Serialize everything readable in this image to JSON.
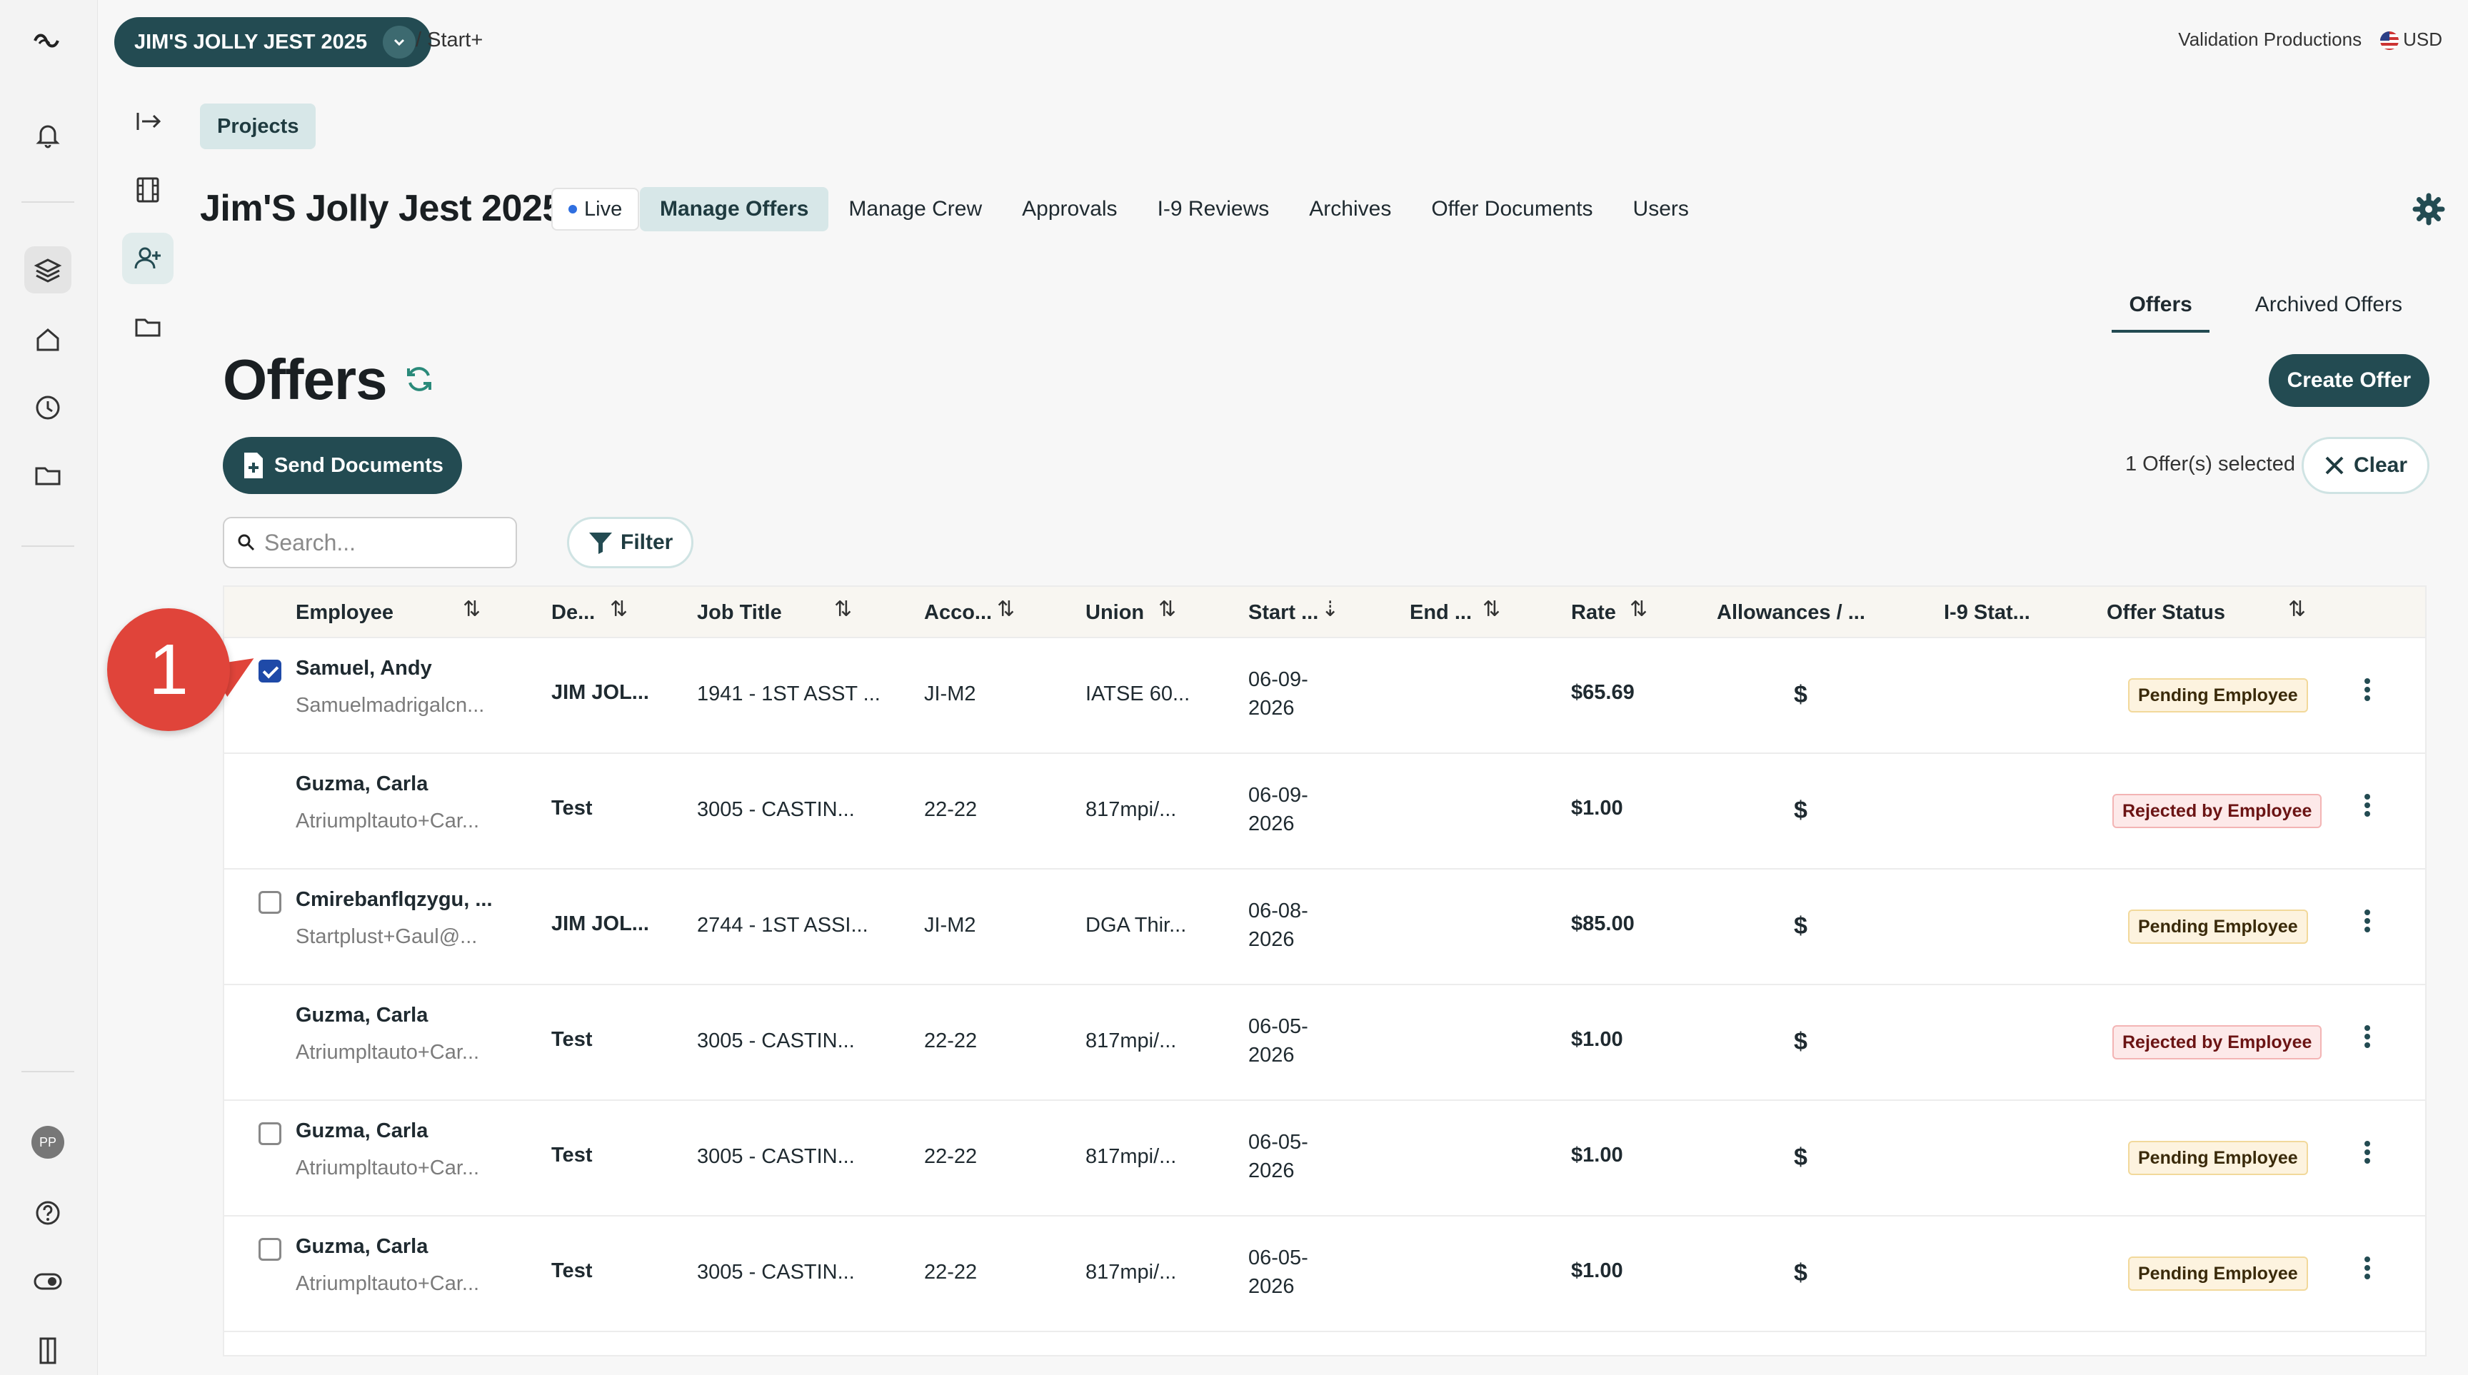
{
  "topbar": {
    "project_pill": "JIM'S JOLLY JEST 2025",
    "breadcrumb": "/ Start+",
    "company": "Validation Productions",
    "currency": "USD"
  },
  "projects_button": "Projects",
  "project": {
    "title": "Jim'S Jolly Jest 2025",
    "status": "Live"
  },
  "nav": [
    {
      "label": "Manage Offers",
      "active": true
    },
    {
      "label": "Manage Crew"
    },
    {
      "label": "Approvals"
    },
    {
      "label": "I-9 Reviews"
    },
    {
      "label": "Archives"
    },
    {
      "label": "Offer Documents"
    },
    {
      "label": "Users"
    }
  ],
  "subtabs": [
    "Offers",
    "Archived Offers"
  ],
  "heading": "Offers",
  "actions": {
    "create_offer": "Create Offer",
    "send_documents": "Send Documents",
    "selected_text": "1 Offer(s) selected",
    "clear": "Clear",
    "filter": "Filter"
  },
  "search": {
    "placeholder": "Search..."
  },
  "columns": [
    "Employee",
    "De...",
    "Job Title",
    "Acco...",
    "Union",
    "Start ...",
    "End ...",
    "Rate",
    "Allowances / ...",
    "I-9 Stat...",
    "Offer Status"
  ],
  "rows": [
    {
      "name": "Samuel, Andy",
      "email": "Samuelmadrigalcn...",
      "dept": "JIM JOL...",
      "job": "1941 - 1ST ASST ...",
      "acct": "JI-M2",
      "union": "IATSE 60...",
      "start1": "06-09-",
      "start2": "2026",
      "rate": "$65.69",
      "allow": "$",
      "status": "Pending Employee",
      "checked": true
    },
    {
      "name": "Guzma, Carla",
      "email": "Atriumpltauto+Car...",
      "dept": "Test",
      "job": "3005 - CASTIN...",
      "acct": "22-22",
      "union": "817mpi/...",
      "start1": "06-09-",
      "start2": "2026",
      "rate": "$1.00",
      "allow": "$",
      "status": "Rejected by Employee"
    },
    {
      "name": "Cmirebanflqzygu, ...",
      "email": "Startplust+Gaul@...",
      "dept": "JIM JOL...",
      "job": "2744 - 1ST ASSI...",
      "acct": "JI-M2",
      "union": "DGA Thir...",
      "start1": "06-08-",
      "start2": "2026",
      "rate": "$85.00",
      "allow": "$",
      "status": "Pending Employee"
    },
    {
      "name": "Guzma, Carla",
      "email": "Atriumpltauto+Car...",
      "dept": "Test",
      "job": "3005 - CASTIN...",
      "acct": "22-22",
      "union": "817mpi/...",
      "start1": "06-05-",
      "start2": "2026",
      "rate": "$1.00",
      "allow": "$",
      "status": "Rejected by Employee"
    },
    {
      "name": "Guzma, Carla",
      "email": "Atriumpltauto+Car...",
      "dept": "Test",
      "job": "3005 - CASTIN...",
      "acct": "22-22",
      "union": "817mpi/...",
      "start1": "06-05-",
      "start2": "2026",
      "rate": "$1.00",
      "allow": "$",
      "status": "Pending Employee"
    },
    {
      "name": "Guzma, Carla",
      "email": "Atriumpltauto+Car...",
      "dept": "Test",
      "job": "3005 - CASTIN...",
      "acct": "22-22",
      "union": "817mpi/...",
      "start1": "06-05-",
      "start2": "2026",
      "rate": "$1.00",
      "allow": "$",
      "status": "Pending Employee"
    }
  ],
  "avatar_initials": "PP",
  "step_marker": "1",
  "colors": {
    "brand": "#234b52",
    "accent_light": "#d7e7e8",
    "pending_bg": "#fdf3df",
    "rejected_bg": "#fde9e9",
    "marker": "#e0443a",
    "checkbox": "#1f4aa8"
  }
}
